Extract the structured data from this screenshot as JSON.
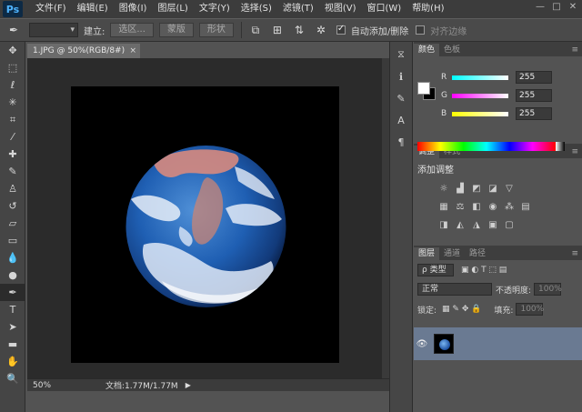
{
  "menubar": {
    "logo": "Ps",
    "items": [
      "文件(F)",
      "编辑(E)",
      "图像(I)",
      "图层(L)",
      "文字(Y)",
      "选择(S)",
      "滤镜(T)",
      "视图(V)",
      "窗口(W)",
      "帮助(H)"
    ],
    "window_controls": [
      "—",
      "□",
      "✕"
    ]
  },
  "options": {
    "establish_label": "建立:",
    "selection_btn": "选区...",
    "mask_btn": "蒙版",
    "shape_btn": "形状",
    "auto_add_delete": "自动添加/删除",
    "align_edges": "对齐边缘"
  },
  "document": {
    "tab_title": "1.JPG @ 50%(RGB/8#)",
    "tab_close": "×",
    "zoom": "50%",
    "doc_size": "文档:1.77M/1.77M"
  },
  "color_panel": {
    "tabs": [
      "颜色",
      "色板"
    ],
    "r_label": "R",
    "r_value": "255",
    "g_label": "G",
    "g_value": "255",
    "b_label": "B",
    "b_value": "255"
  },
  "adjust_panel": {
    "tabs": [
      "调整",
      "样式"
    ],
    "title": "添加调整"
  },
  "layers_panel": {
    "tabs": [
      "图层",
      "通道",
      "路径"
    ],
    "kind_label": "ρ 类型",
    "blend_mode": "正常",
    "opacity_label": "不透明度:",
    "opacity_value": "100%",
    "lock_label": "锁定:",
    "fill_label": "填充:",
    "fill_value": "100%"
  },
  "colors": {
    "menubar_bg": "#3c3c3c",
    "panel_bg": "#535353",
    "canvas_bg": "#000000",
    "selected_layer": "#6a7a92"
  }
}
